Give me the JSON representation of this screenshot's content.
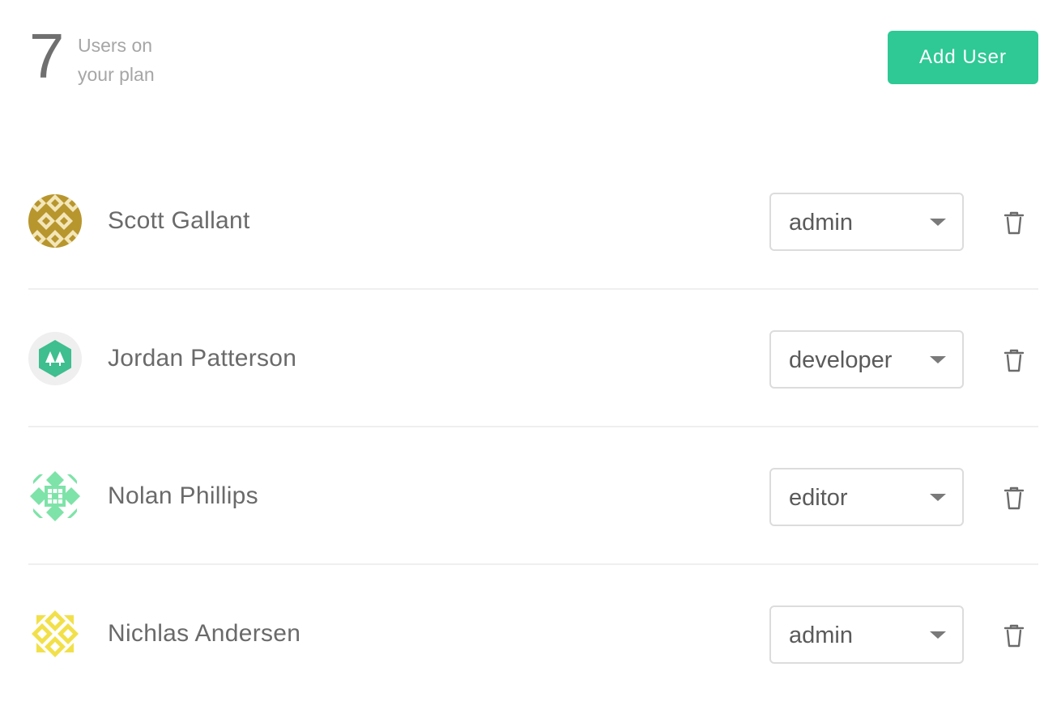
{
  "plan": {
    "count": "7",
    "label_line1": "Users on",
    "label_line2": "your plan"
  },
  "add_button_label": "Add User",
  "colors": {
    "accent": "#2ec995",
    "border": "#dcdcdc",
    "divider": "#efefef"
  },
  "users": [
    {
      "name": "Scott Gallant",
      "role": "admin",
      "avatar_icon": "gold-pattern-avatar"
    },
    {
      "name": "Jordan Patterson",
      "role": "developer",
      "avatar_icon": "green-hexagon-trees-avatar"
    },
    {
      "name": "Nolan Phillips",
      "role": "editor",
      "avatar_icon": "green-pattern-avatar"
    },
    {
      "name": "Nichlas Andersen",
      "role": "admin",
      "avatar_icon": "yellow-pattern-avatar"
    }
  ]
}
